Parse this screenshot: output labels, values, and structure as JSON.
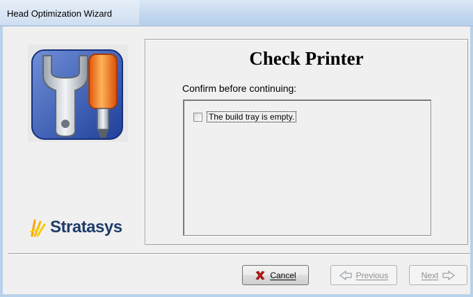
{
  "window": {
    "title": "Head Optimization Wizard"
  },
  "sidebar": {
    "logo_icon": "wrench-screwdriver-icon",
    "brand_name": "Stratasys"
  },
  "main": {
    "page_title": "Check Printer",
    "confirm_label": "Confirm before continuing:",
    "checklist": [
      {
        "label": "The build tray is empty.",
        "checked": false
      }
    ]
  },
  "buttons": {
    "cancel_label": "Cancel",
    "previous_label": "Previous",
    "next_label": "Next",
    "previous_enabled": false,
    "next_enabled": false
  },
  "colors": {
    "brand_text": "#1f3c69",
    "cancel_icon": "#c0140e",
    "titlebar": "#c3d8ef"
  }
}
